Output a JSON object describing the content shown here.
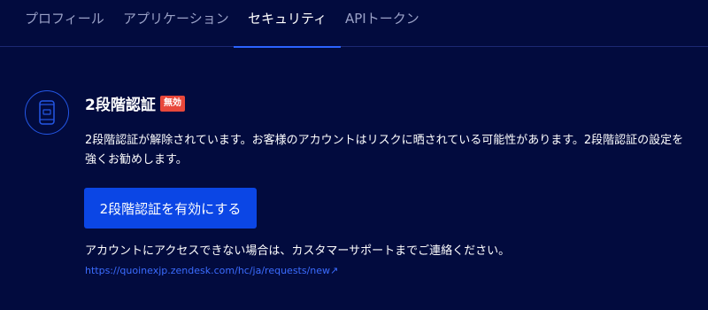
{
  "tabs": [
    {
      "label": "プロフィール",
      "active": false
    },
    {
      "label": "アプリケーション",
      "active": false
    },
    {
      "label": "セキュリティ",
      "active": true
    },
    {
      "label": "APIトークン",
      "active": false
    }
  ],
  "two_factor": {
    "icon": "mobile-device-icon",
    "title": "2段階認証",
    "status_badge": "無効",
    "description": "2段階認証が解除されています。お客様のアカウントはリスクに晒されている可能性があります。2段階認証の設定を強くお勧めします。",
    "enable_button_label": "2段階認証を有効にする",
    "support_text": "アカウントにアクセスできない場合は、カスタマーサポートまでご連絡ください。",
    "support_link": "https://quoinexjp.zendesk.com/hc/ja/requests/new↗"
  },
  "colors": {
    "background": "#020b3e",
    "accent": "#0b46e5",
    "badge": "#e8483b",
    "link": "#3b6cff"
  }
}
